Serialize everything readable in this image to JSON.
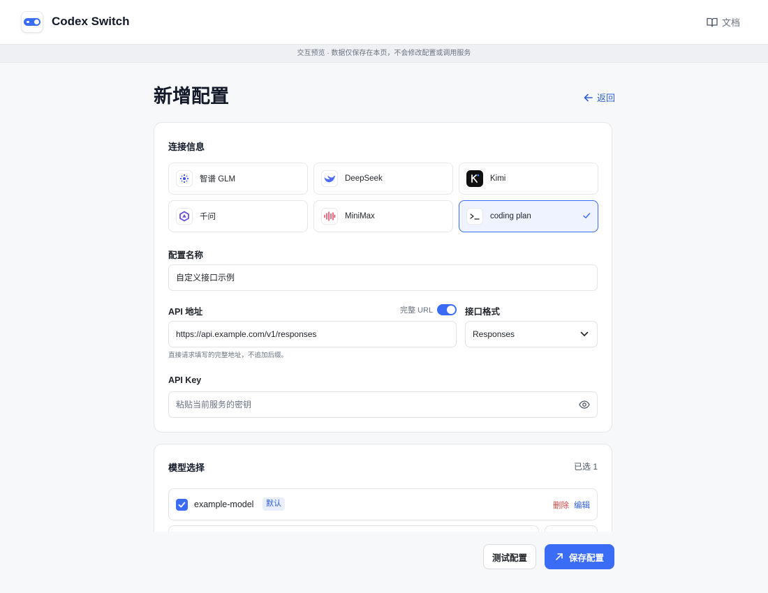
{
  "app": {
    "title": "Codex Switch",
    "docs_label": "文档"
  },
  "notice": "交互预览 · 数据仅保存在本页，不会修改配置或调用服务",
  "page": {
    "title": "新增配置",
    "back_label": "返回"
  },
  "connection": {
    "section_title": "连接信息",
    "providers": [
      {
        "label": "智谱 GLM",
        "icon": "zhipu-icon",
        "selected": false
      },
      {
        "label": "DeepSeek",
        "icon": "deepseek-whale-icon",
        "selected": false
      },
      {
        "label": "Kimi",
        "icon": "kimi-icon",
        "selected": false
      },
      {
        "label": "千问",
        "icon": "qwen-icon",
        "selected": false
      },
      {
        "label": "MiniMax",
        "icon": "minimax-waveform-icon",
        "selected": false
      },
      {
        "label": "coding plan",
        "icon": "terminal-icon",
        "selected": true
      }
    ],
    "name_label": "配置名称",
    "name_value": "自定义接口示例",
    "api_url_label": "API 地址",
    "full_url_label": "完整 URL",
    "full_url_enabled": true,
    "api_url_value": "https://api.example.com/v1/responses",
    "api_url_hint": "直接请求填写的完整地址，不追加后缀。",
    "format_label": "接口格式",
    "format_value": "Responses",
    "api_key_label": "API Key",
    "api_key_placeholder": "粘贴当前服务的密钥"
  },
  "models": {
    "section_title": "模型选择",
    "selected_count": "已选 1",
    "items": [
      {
        "name": "example-model",
        "badge": "默认",
        "checked": true,
        "delete_label": "删除",
        "edit_label": "编辑"
      }
    ]
  },
  "actions": {
    "test_label": "测试配置",
    "save_label": "保存配置"
  },
  "colors": {
    "accent": "#3b6cf6",
    "danger": "#d14343",
    "link": "#2f5fd7"
  }
}
